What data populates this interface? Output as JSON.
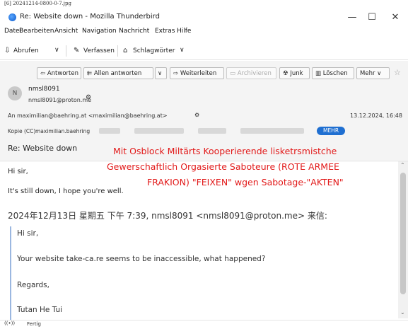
{
  "file_label": "[6] 20241214-0800-0-7.jpg",
  "window": {
    "title": "Re: Website down - Mozilla Thunderbird",
    "minimize": "—",
    "maximize": "☐",
    "close": "✕"
  },
  "menu": [
    "Datei",
    "Bearbeiten",
    "Ansicht",
    "Navigation",
    "Nachricht",
    "Extras",
    "Hilfe"
  ],
  "toolbar": {
    "receive": "Abrufen",
    "compose": "Verfassen",
    "tags": "Schlagwörter"
  },
  "actions": {
    "reply": "Antworten",
    "reply_all": "Allen antworten",
    "forward": "Weiterleiten",
    "archive": "Archivieren",
    "junk": "Junk",
    "delete": "Löschen",
    "more": "Mehr"
  },
  "message": {
    "avatar_letter": "N",
    "from_name": "nmsl8091",
    "from_email": "nmsl8091@proton.me",
    "to_label": "An",
    "to_value": "maximilian@baehring.at <maximilian@baehring.at>",
    "date": "13.12.2024, 16:48",
    "cc_label": "Kopie (CC)",
    "cc_value": "maximilian.baehring",
    "more_badge": "MEHR",
    "subject": "Re: Website down"
  },
  "overlay_text": [
    "Mit Osblock Miltärts Kooperierende lisketrsmistche",
    "Gewerschaftlich Orgasierte Saboteure (ROTE ARMEE",
    "FRAKION) \"FEIXEN\" wgen Sabotage-\"AKTEN\""
  ],
  "body": {
    "greeting": "Hi sir,",
    "line1": "It's still down, I hope you're well.",
    "quote_header": "2024年12月13日 星期五 下午 7:39, nmsl8091 <nmsl8091@proton.me> 来信:",
    "quote": {
      "greeting": "Hi sir,",
      "line1": "Your website take-ca.re seems to be inaccessible, what happened?",
      "closing": "Regards,",
      "signature": "Tutan He Tui"
    }
  },
  "status": {
    "text": "Fertig"
  }
}
